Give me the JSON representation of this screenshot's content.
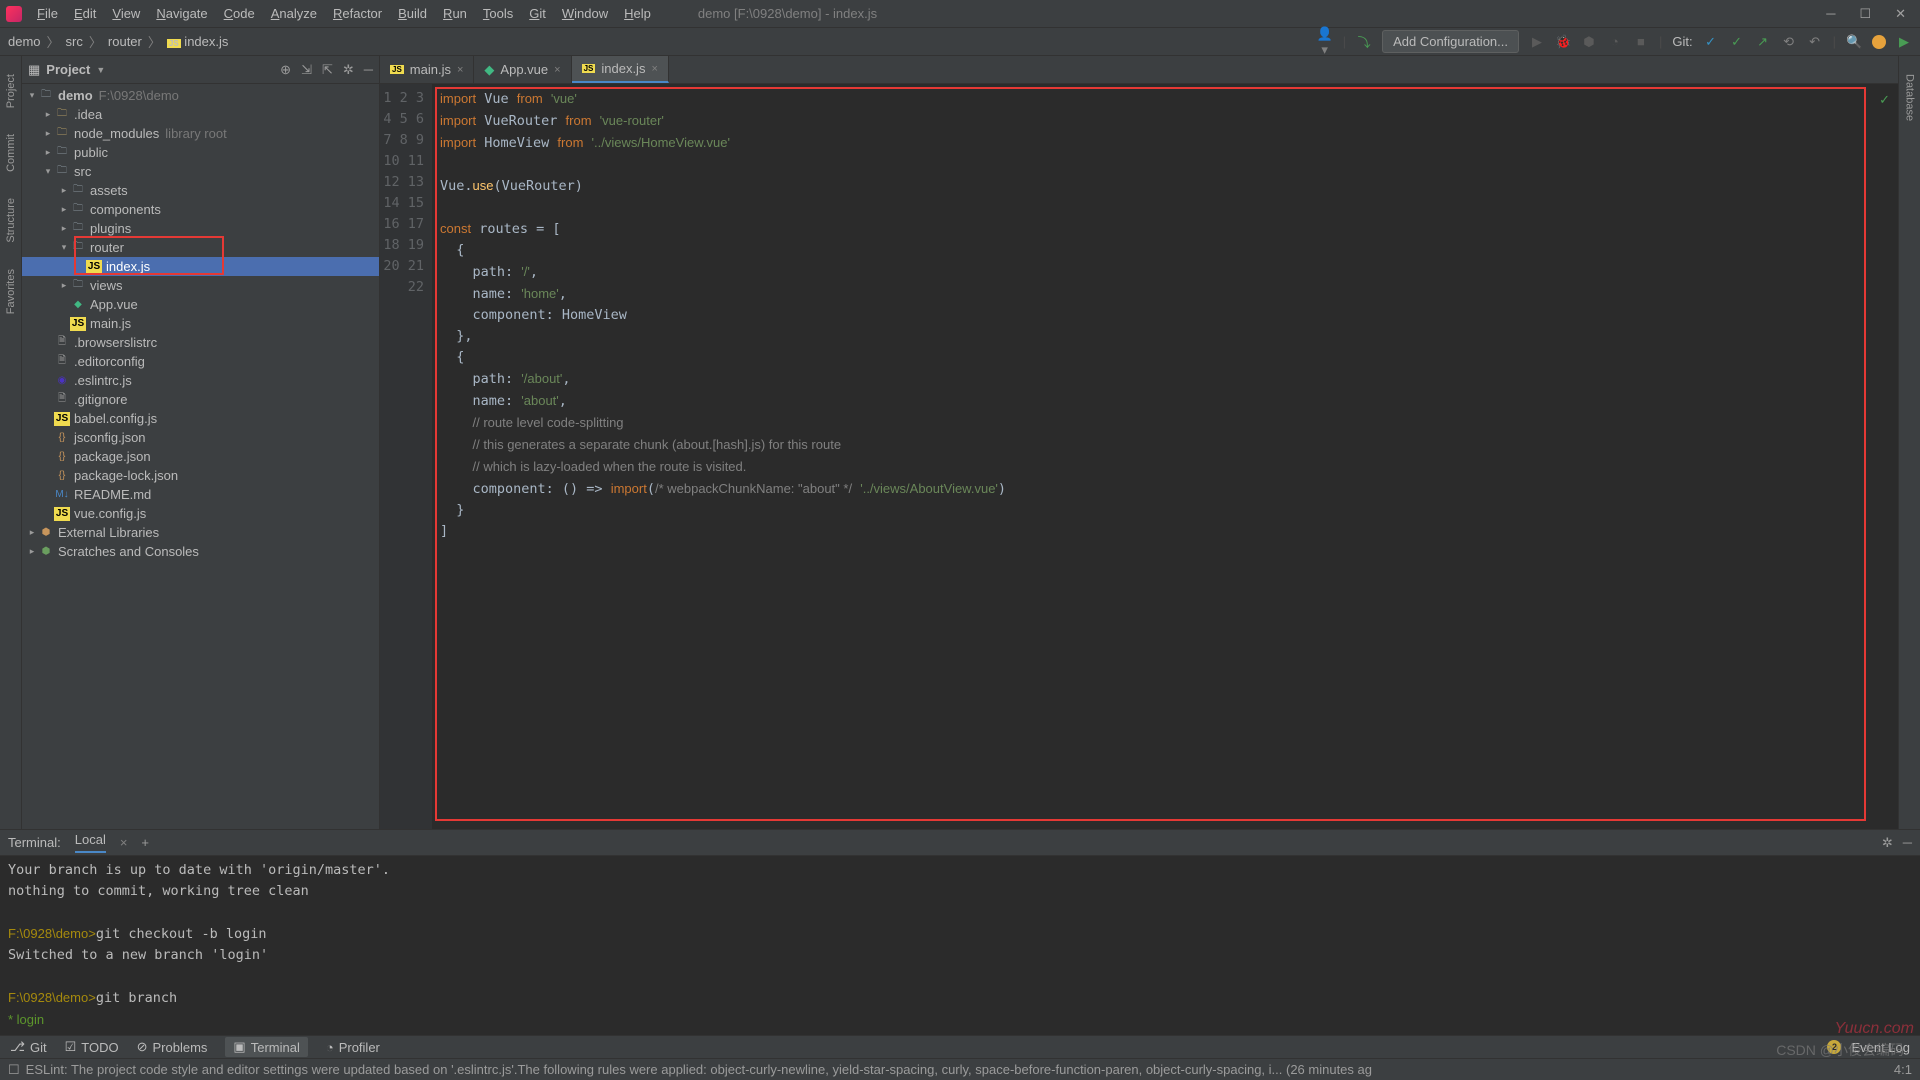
{
  "window": {
    "title": "demo [F:\\0928\\demo] - index.js"
  },
  "menu": [
    "File",
    "Edit",
    "View",
    "Navigate",
    "Code",
    "Analyze",
    "Refactor",
    "Build",
    "Run",
    "Tools",
    "Git",
    "Window",
    "Help"
  ],
  "breadcrumb": [
    "demo",
    "src",
    "router",
    "index.js"
  ],
  "nav": {
    "config": "Add Configuration...",
    "git_label": "Git:"
  },
  "sidebar_left": [
    "Project",
    "Commit",
    "Structure",
    "Favorites"
  ],
  "sidebar_right": [
    "Database"
  ],
  "project": {
    "title": "Project",
    "root_name": "demo",
    "root_path": "F:\\0928\\demo",
    "items": [
      {
        "d": 1,
        "name": ".idea",
        "t": "folder-tan",
        "ex": false
      },
      {
        "d": 1,
        "name": "node_modules",
        "t": "folder-tan",
        "hint": "library root",
        "ex": false
      },
      {
        "d": 1,
        "name": "public",
        "t": "folder",
        "ex": false
      },
      {
        "d": 1,
        "name": "src",
        "t": "folder",
        "ex": true
      },
      {
        "d": 2,
        "name": "assets",
        "t": "folder",
        "ex": false
      },
      {
        "d": 2,
        "name": "components",
        "t": "folder",
        "ex": false
      },
      {
        "d": 2,
        "name": "plugins",
        "t": "folder",
        "ex": false
      },
      {
        "d": 2,
        "name": "router",
        "t": "folder",
        "ex": true,
        "hl": true
      },
      {
        "d": 3,
        "name": "index.js",
        "t": "js",
        "sel": true,
        "hl": true
      },
      {
        "d": 2,
        "name": "views",
        "t": "folder",
        "ex": false
      },
      {
        "d": 2,
        "name": "App.vue",
        "t": "vue"
      },
      {
        "d": 2,
        "name": "main.js",
        "t": "js"
      },
      {
        "d": 1,
        "name": ".browserslistrc",
        "t": "file"
      },
      {
        "d": 1,
        "name": ".editorconfig",
        "t": "file"
      },
      {
        "d": 1,
        "name": ".eslintrc.js",
        "t": "eslint"
      },
      {
        "d": 1,
        "name": ".gitignore",
        "t": "file"
      },
      {
        "d": 1,
        "name": "babel.config.js",
        "t": "js"
      },
      {
        "d": 1,
        "name": "jsconfig.json",
        "t": "json"
      },
      {
        "d": 1,
        "name": "package.json",
        "t": "json"
      },
      {
        "d": 1,
        "name": "package-lock.json",
        "t": "json"
      },
      {
        "d": 1,
        "name": "README.md",
        "t": "md"
      },
      {
        "d": 1,
        "name": "vue.config.js",
        "t": "js"
      }
    ],
    "ext_lib": "External Libraries",
    "scratches": "Scratches and Consoles"
  },
  "editor_tabs": [
    {
      "name": "main.js",
      "t": "js"
    },
    {
      "name": "App.vue",
      "t": "vue"
    },
    {
      "name": "index.js",
      "t": "js",
      "active": true
    }
  ],
  "code_lines": 22,
  "terminal": {
    "label": "Terminal:",
    "tab": "Local",
    "lines": [
      "Your branch is up to date with 'origin/master'.",
      "nothing to commit, working tree clean",
      "",
      "F:\\0928\\demo>git checkout -b login",
      "Switched to a new branch 'login'",
      "",
      "F:\\0928\\demo>git branch",
      "* login"
    ]
  },
  "bottom_tabs": [
    "Git",
    "TODO",
    "Problems",
    "Terminal",
    "Profiler"
  ],
  "event_log": "Event Log",
  "event_badge": "2",
  "status_bar": {
    "msg": "ESLint: The project code style and editor settings were updated based on '.eslintrc.js'.The following rules were applied: object-curly-newline, yield-star-spacing, curly, space-before-function-paren, object-curly-spacing, i... (26 minutes ag",
    "pos": "4:1",
    "encoding": ""
  },
  "watermark": "Yuucn.com",
  "csdn": "CSDN @小俊会编码"
}
